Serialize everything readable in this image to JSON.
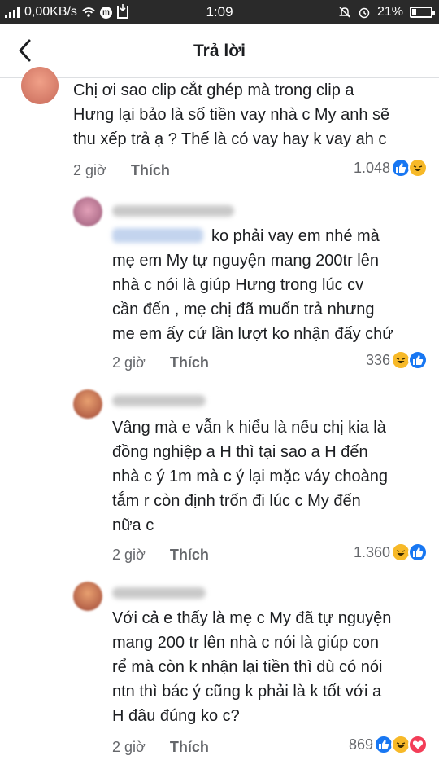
{
  "status_bar": {
    "network_speed": "0,00KB/s",
    "time": "1:09",
    "battery": "21%",
    "battery_level": 0.21,
    "icons": [
      "signal-icon",
      "wifi-icon",
      "messenger-icon",
      "download-icon",
      "mute-icon",
      "alarm-icon",
      "battery-icon"
    ]
  },
  "header": {
    "title": "Trả lời",
    "back_icon": "back-arrow-icon"
  },
  "comments": [
    {
      "lines": [
        "Chị ơi sao clip cắt ghép mà trong clip a",
        "Hưng lại bảo là số tiền vay nhà c My anh sẽ",
        "thu xếp trả ạ ? Thế là có vay hay k vay ah c"
      ],
      "time": "2 giờ",
      "like_label": "Thích",
      "reaction_count": "1.048",
      "reactions": [
        "like",
        "haha"
      ]
    },
    {
      "author": "Nguyễn Hà Nhi",
      "mention": "Khánh Linh",
      "lines": [
        "ko phải vay em nhé mà",
        "mẹ em My tự nguyện mang 200tr lên",
        "nhà c nói là giúp Hưng  trong lúc cv",
        "cần đến , mẹ chị đã muốn trả nhưng",
        "me em ấy cứ lần lượt ko nhận đấy chứ"
      ],
      "time": "2 giờ",
      "like_label": "Thích",
      "reaction_count": "336",
      "reactions": [
        "haha",
        "like"
      ]
    },
    {
      "author": "Khánh Linh",
      "lines": [
        "Vâng mà e vẫn k hiểu là nếu chị kia là",
        "đồng nghiệp a H thì tại sao a H đến",
        "nhà c ý 1m mà c ý lại mặc váy choàng",
        "tắm r còn định trốn đi lúc c My đến",
        "nữa c"
      ],
      "time": "2 giờ",
      "like_label": "Thích",
      "reaction_count": "1.360",
      "reactions": [
        "haha",
        "like"
      ]
    },
    {
      "author": "Khánh Linh",
      "lines": [
        "Với cả e thấy là mẹ c My đã tự nguyện",
        "mang 200 tr lên nhà c nói là giúp con",
        "rể mà còn k nhận lại tiền thì dù có nói",
        "ntn thì bác ý cũng k phải là k tốt với a",
        "H đâu đúng ko c?"
      ],
      "time": "2 giờ",
      "like_label": "Thích",
      "reaction_count": "869",
      "reactions": [
        "like",
        "haha",
        "love"
      ]
    }
  ]
}
